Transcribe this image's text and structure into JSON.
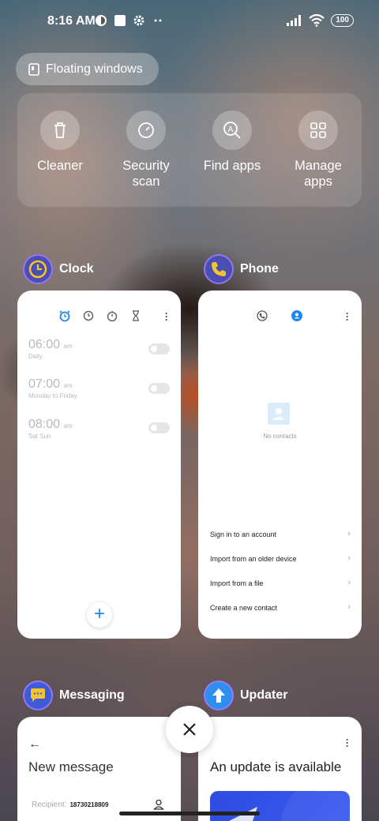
{
  "status": {
    "time": "8:16 AM",
    "battery": "100"
  },
  "floating_windows": {
    "label": "Floating windows"
  },
  "quick_actions": [
    {
      "label": "Cleaner",
      "icon": "trash-icon"
    },
    {
      "label": "Security\nscan",
      "icon": "security-scan-icon"
    },
    {
      "label": "Find apps",
      "icon": "find-apps-icon"
    },
    {
      "label": "Manage\napps",
      "icon": "grid-icon"
    }
  ],
  "apps": {
    "clock": {
      "name": "Clock",
      "alarms": [
        {
          "time": "06:00",
          "ampm": "am",
          "days": "Daily"
        },
        {
          "time": "07:00",
          "ampm": "am",
          "days": "Monday to Friday"
        },
        {
          "time": "08:00",
          "ampm": "am",
          "days": "Sat Sun"
        }
      ],
      "fab": "+"
    },
    "phone": {
      "name": "Phone",
      "empty_text": "No contacts",
      "options": [
        "Sign in to an account",
        "Import from an older device",
        "Import from a file",
        "Create a new contact"
      ]
    },
    "messaging": {
      "name": "Messaging",
      "title": "New message",
      "recipient_label": "Recipient:",
      "recipient_value": "18730218809"
    },
    "updater": {
      "name": "Updater",
      "title": "An update is available"
    }
  },
  "colors": {
    "accent": "#1a88f0",
    "icon_ring": "#a078ff"
  }
}
